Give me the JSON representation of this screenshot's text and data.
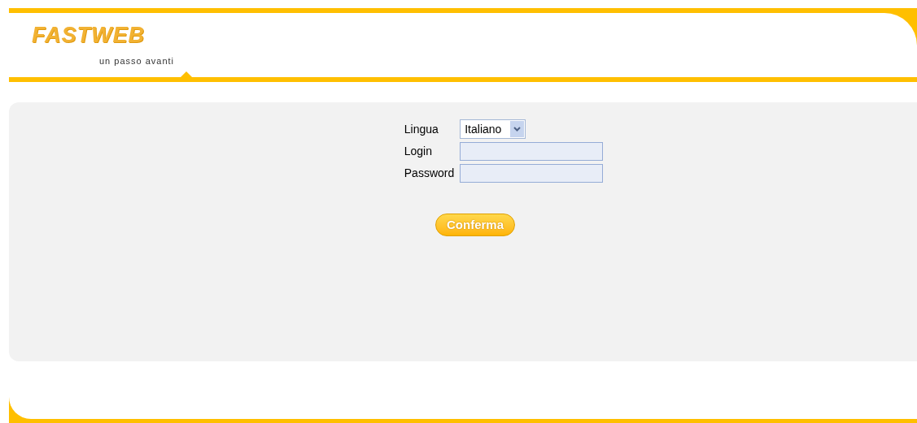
{
  "logo": {
    "brand": "FASTWEB",
    "tagline": "un passo avanti"
  },
  "form": {
    "fields": [
      {
        "label": "Lingua",
        "kind": "select",
        "value": "Italiano"
      },
      {
        "label": "Login",
        "kind": "text"
      },
      {
        "label": "Password",
        "kind": "password"
      }
    ],
    "submit": "Conferma"
  }
}
